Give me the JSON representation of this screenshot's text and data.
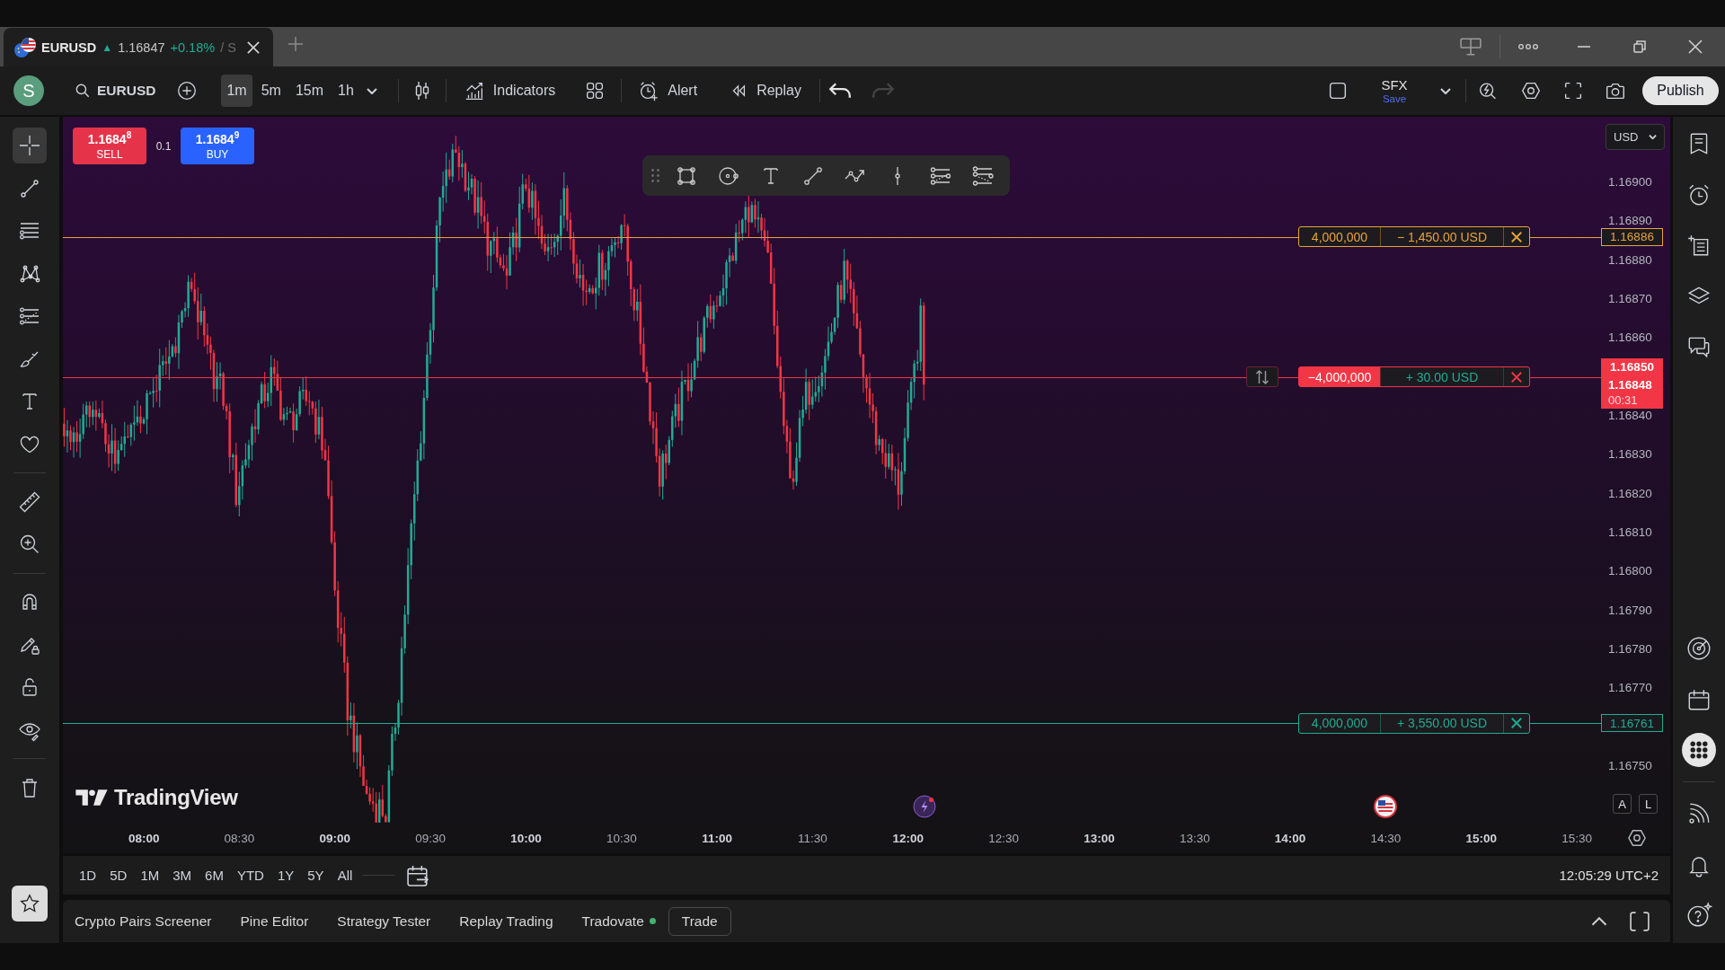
{
  "tab_bar": {
    "tab": {
      "symbol": "EURUSD",
      "arrow": "▲",
      "price": "1.16847",
      "change": "+0.18%",
      "trailing": "/ S"
    }
  },
  "toolbar": {
    "avatar": "S",
    "symbol": "EURUSD",
    "intervals": [
      {
        "label": "1m",
        "selected": true
      },
      {
        "label": "5m",
        "selected": false
      },
      {
        "label": "15m",
        "selected": false
      },
      {
        "label": "1h",
        "selected": false
      }
    ],
    "indicators": "Indicators",
    "alert": "Alert",
    "replay": "Replay",
    "history": [
      {
        "kind": "undo",
        "disabled": false
      },
      {
        "kind": "redo",
        "disabled": true
      }
    ],
    "layout": {
      "name": "SFX",
      "status": "Save"
    },
    "publish": "Publish"
  },
  "left_toolbar": {
    "tool_groups": [
      {
        "tools": [
          {
            "kind": "crosshair",
            "selected": true
          },
          {
            "kind": "trend_line",
            "selected": false
          },
          {
            "kind": "parallel_lines",
            "selected": false
          },
          {
            "kind": "pattern",
            "selected": false
          },
          {
            "kind": "fib_levels",
            "selected": false
          },
          {
            "kind": "brush",
            "selected": false
          },
          {
            "kind": "text",
            "selected": false
          },
          {
            "kind": "heart",
            "selected": false
          }
        ]
      },
      {
        "tools": [
          {
            "kind": "ruler",
            "selected": false
          },
          {
            "kind": "zoom",
            "selected": false
          }
        ]
      },
      {
        "tools": [
          {
            "kind": "magnet",
            "selected": false
          },
          {
            "kind": "lock_drawing",
            "selected": false
          },
          {
            "kind": "lock",
            "selected": false
          },
          {
            "kind": "eye",
            "selected": false
          }
        ]
      },
      {
        "tools": [
          {
            "kind": "trash",
            "selected": false
          }
        ]
      }
    ]
  },
  "chart": {
    "order_panel": {
      "sell": {
        "price": "1.1684$^{8}$",
        "label": "SELL"
      },
      "spread": "0.1",
      "buy": {
        "price": "1.1684$^{9}$",
        "label": "BUY"
      }
    },
    "price_axis": {
      "currency": "USD",
      "ticks": [
        "1.16900",
        "1.16890",
        "1.16880",
        "1.16870",
        "1.16860",
        "1.16840",
        "1.16830",
        "1.16820",
        "1.16810",
        "1.16800",
        "1.16790",
        "1.16780",
        "1.16770",
        "1.16750"
      ],
      "last_price": "1.16848",
      "countdown": "00:31"
    },
    "order_lines": [
      {
        "kind": "stop_loss",
        "quantity": "4,000,000",
        "pnl": "− 1,450.00 USD",
        "price": "1.16886"
      },
      {
        "kind": "position",
        "quantity": "−4,000,000",
        "pnl": "+ 30.00 USD",
        "price": "1.16850"
      },
      {
        "kind": "take_profit",
        "quantity": "4,000,000",
        "pnl": "+ 3,550.00 USD",
        "price": "1.16761"
      }
    ],
    "time_axis": {
      "ticks": [
        {
          "label": "08:00",
          "major": true
        },
        {
          "label": "08:30",
          "major": false
        },
        {
          "label": "09:00",
          "major": true
        },
        {
          "label": "09:30",
          "major": false
        },
        {
          "label": "10:00",
          "major": true
        },
        {
          "label": "10:30",
          "major": false
        },
        {
          "label": "11:00",
          "major": true
        },
        {
          "label": "11:30",
          "major": false
        },
        {
          "label": "12:00",
          "major": true
        },
        {
          "label": "12:30",
          "major": false
        },
        {
          "label": "13:00",
          "major": true
        },
        {
          "label": "13:30",
          "major": false
        },
        {
          "label": "14:00",
          "major": true
        },
        {
          "label": "14:30",
          "major": false
        },
        {
          "label": "15:00",
          "major": true
        },
        {
          "label": "15:30",
          "major": false
        }
      ]
    },
    "logo": "TradingView",
    "scale_buttons": [
      "A",
      "L"
    ]
  },
  "range_bar": {
    "ranges": [
      "1D",
      "5D",
      "1M",
      "3M",
      "6M",
      "YTD",
      "1Y",
      "5Y",
      "All"
    ],
    "clock": "12:05:29 UTC+2"
  },
  "bottom_panel": {
    "tabs": [
      {
        "kind": "tab",
        "label": "Crypto Pairs Screener"
      },
      {
        "kind": "tab",
        "label": "Pine Editor"
      },
      {
        "kind": "tab",
        "label": "Strategy Tester"
      },
      {
        "kind": "tab",
        "label": "Replay Trading"
      },
      {
        "kind": "broker",
        "label": "Tradovate",
        "color": "#3fb56e"
      },
      {
        "kind": "button",
        "label": "Trade"
      }
    ]
  }
}
